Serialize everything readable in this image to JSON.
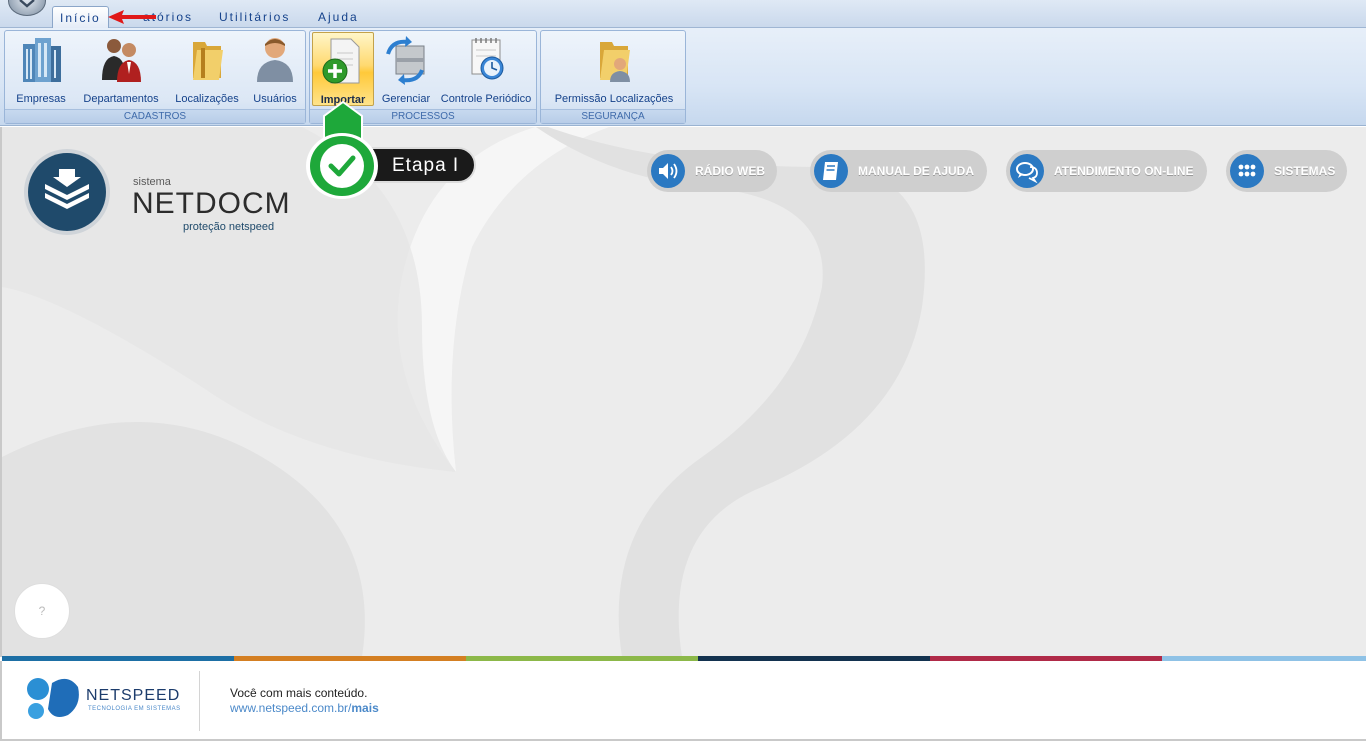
{
  "ribbon": {
    "tabs": [
      {
        "label": "Início"
      },
      {
        "label": "Relatórios"
      },
      {
        "label": "Utilitários"
      },
      {
        "label": "Ajuda"
      }
    ],
    "tab_visible_fragment": "atórios",
    "groups": [
      {
        "label": "CADASTROS",
        "buttons": [
          "Empresas",
          "Departamentos",
          "Localizações",
          "Usuários"
        ]
      },
      {
        "label": "PROCESSOS",
        "buttons": [
          "Importar",
          "Gerenciar",
          "Controle Periódico"
        ]
      },
      {
        "label": "SEGURANÇA",
        "buttons": [
          "Permissão Localizações"
        ]
      }
    ]
  },
  "logo": {
    "small": "sistema",
    "title": "NETDOCM",
    "subtitle": "proteção netspeed"
  },
  "actions": [
    {
      "label": "RÁDIO WEB",
      "icon": "speaker-icon"
    },
    {
      "label": "MANUAL DE AJUDA",
      "icon": "book-icon"
    },
    {
      "label": "ATENDIMENTO ON-LINE",
      "icon": "chat-icon"
    },
    {
      "label": "SISTEMAS",
      "icon": "grid-dots-icon"
    }
  ],
  "callout": {
    "label": "Etapa I"
  },
  "help": {
    "label": "?"
  },
  "footer": {
    "brand": "NETSPEED",
    "brand_tagline": "TECNOLOGIA EM SISTEMAS",
    "line1": "Você com mais conteúdo.",
    "url_prefix": "www.netspeed.com.br/",
    "url_suffix": "mais"
  },
  "colors": {
    "stripes": [
      "#1d6fa5",
      "#d47f22",
      "#8cb849",
      "#13324f",
      "#b02a48",
      "#8fc2e6"
    ],
    "accent": "#2b79c2",
    "callout_green": "#1ea83a"
  }
}
